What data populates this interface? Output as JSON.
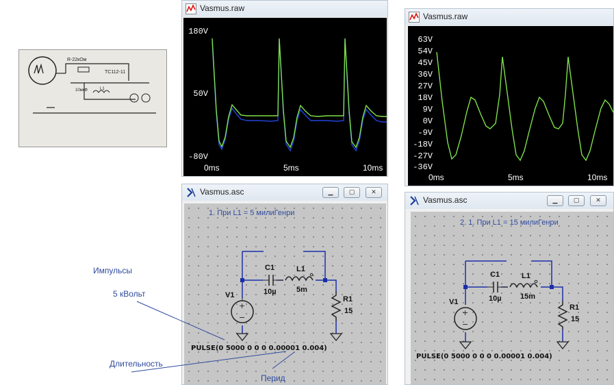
{
  "photo": {
    "note_text": "R-22кОм",
    "note2": "TC112-11",
    "note3": "10мкФ",
    "note4": "L1"
  },
  "raw_left": {
    "title": "Vasmus.raw",
    "y_ticks": [
      "180V",
      "50V",
      "-80V"
    ],
    "x_ticks": [
      "0ms",
      "5ms",
      "10ms"
    ]
  },
  "raw_right": {
    "title": "Vasmus.raw",
    "y_ticks": [
      "63V",
      "54V",
      "45V",
      "36V",
      "27V",
      "18V",
      "9V",
      "0V",
      "-9V",
      "-18V",
      "-27V",
      "-36V"
    ],
    "x_ticks": [
      "0ms",
      "5ms",
      "10ms"
    ]
  },
  "asc_left": {
    "title": "Vasmus.asc",
    "heading": "1. При L1 = 5 милиГенри",
    "c1": "C1",
    "c1_val": "10µ",
    "l1": "L1",
    "l1_val": "5m",
    "r1": "R1",
    "r1_val": "15",
    "v1": "V1",
    "pulse": "PULSE(0 5000 0 0 0 0.00001 0.004)"
  },
  "asc_right": {
    "title": "Vasmus.asc",
    "heading": "2. 1. При L1 = 15 милиГенри",
    "c1": "C1",
    "c1_val": "10µ",
    "l1": "L1",
    "l1_val": "15m",
    "r1": "R1",
    "r1_val": "15",
    "v1": "V1",
    "pulse": "PULSE(0 5000 0 0 0 0.00001 0.004)"
  },
  "annotations": {
    "impulses": "Импульсы",
    "kv": "5 кВольт",
    "duration": "Длительность",
    "period": "Перид"
  },
  "colors": {
    "trace_green": "#7fe04a",
    "trace_blue": "#2244dd",
    "annotation": "#2e4a9e"
  }
}
